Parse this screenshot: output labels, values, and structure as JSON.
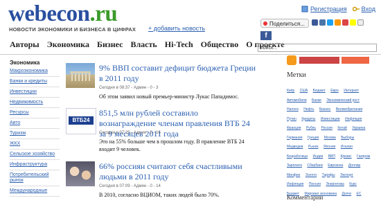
{
  "logo": {
    "part1": "webecon",
    "part2": ".ru"
  },
  "tagline": "НОВОСТИ ЭКОНОМИКИ И БИЗНЕСА В ЦИФРАХ",
  "add_news": "+ добавить новость",
  "top_links": {
    "register": "Регистрация",
    "login": "Вход"
  },
  "share": "Поделиться...",
  "nav": [
    "Авторы",
    "Экономика",
    "Бизнес",
    "Власть",
    "Hi-Tech",
    "Общество",
    "О проекте"
  ],
  "search": {
    "value": "поиск..."
  },
  "sidebar": {
    "title": "Экономика",
    "items": [
      "Макроэкономика",
      "Банки и кредиты",
      "Инвестиции",
      "Недвижимость",
      "Ресурсы",
      "Авто",
      "Туризм",
      "ЖКХ",
      "Сельское хозяйство",
      "Инфраструктура",
      "Потребительский рынок",
      "Международные"
    ]
  },
  "articles": [
    {
      "title": "9% ВВП составит дефицит бюджета Греции в 2011 году",
      "meta": "Сегодня в 08:37 - Админ - 0 - 3",
      "excerpt": "Об этом заявил новый премьер-министр Лукас Пападимос."
    },
    {
      "title": "851,5 млн рублей составило вознаграждение членам правления ВТБ 24 за 9 месяцев 2011 года",
      "meta": "Сегодня в 07:25 - Админ - 0 - 16",
      "excerpt": "Это на 55% больше чем в прошлом году. В правление ВТБ 24 входит 9 человек.",
      "thumb_label": "ВТБ24"
    },
    {
      "title": "66% россиян считают себя счастливыми людьми в 2011 году",
      "meta": "Сегодня в 07:09 - Админ - 0 - 14",
      "excerpt": "В 2010, согласно ВЦИОМ, таких людей было 70%."
    }
  ],
  "right": {
    "metki": "Метки",
    "tags": [
      "Кипр",
      "США",
      "Бюджет",
      "Евро",
      "Интернет",
      "Автомобили",
      "Банки",
      "Экономический рост",
      "Налоги",
      "Нефть",
      "Бизнес",
      "Великобритания",
      "Путин",
      "Кредиты",
      "Инвестиции",
      "Инфляция",
      "Франция",
      "Рубль",
      "Россия",
      "Китай",
      "Украина",
      "Германия",
      "Греция",
      "Москва",
      "Выборы",
      "Медведев",
      "Рынок",
      "Япония",
      "Италия",
      "Безработица",
      "Индия",
      "ВВП",
      "Кризис",
      "Газпром",
      "Зарплата",
      "Сбербанк",
      "Еврозона",
      "Доллар",
      "Минфин",
      "Золото",
      "Тарифы",
      "Экспорт",
      "Инфляция",
      "Пенсия",
      "Энергетика",
      "Курс",
      "Бюджет",
      "Мировая экономика",
      "Долги",
      "ЕС"
    ],
    "comments": "Комментарии"
  },
  "colors": {
    "link": "#2a5fb0",
    "logo_blue": "#2a4fa0",
    "logo_green": "#3a9a2a"
  }
}
